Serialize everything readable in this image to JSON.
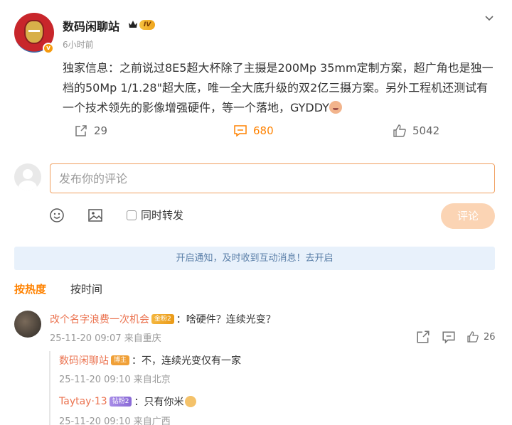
{
  "post": {
    "username": "数码闲聊站",
    "level": "IV",
    "time": "6小时前",
    "content": "独家信息：之前说过8E5超大杯除了主摄是200Mp 35mm定制方案，超广角也是独一档的50Mp 1/1.28\"超大底，唯一全大底升级的双2亿三摄方案。另外工程机还测试有一个技术领先的影像增强硬件，等一个落地，GYDDY",
    "verify_mark": "v"
  },
  "actions": {
    "reposts": "29",
    "comments": "680",
    "likes": "5042"
  },
  "composer": {
    "placeholder": "发布你的评论",
    "repost_label": "同时转发",
    "submit_label": "评论"
  },
  "notice": {
    "text": "开启通知，及时收到互动消息！去开启"
  },
  "sort_tabs": [
    "按热度",
    "按时间"
  ],
  "comment": {
    "user": "改个名字浪费一次机会",
    "badge": "金粉2",
    "text": "：啥硬件？连续光变？",
    "meta": "25-11-20 09:07 来自重庆",
    "likes": "26"
  },
  "replies": [
    {
      "user": "数码闲聊站",
      "badge": "博主",
      "text": "：不，连续光变仅有一家",
      "meta": "25-11-20 09:10 来自北京"
    },
    {
      "user": "Taytay·13",
      "badge": "钻粉2",
      "text": "：只有你米",
      "meta": "25-11-20 09:10 来自广西"
    }
  ],
  "colors": {
    "accent": "#ff8200",
    "username": "#eb7350",
    "notice_bg": "#e8f1fb"
  }
}
